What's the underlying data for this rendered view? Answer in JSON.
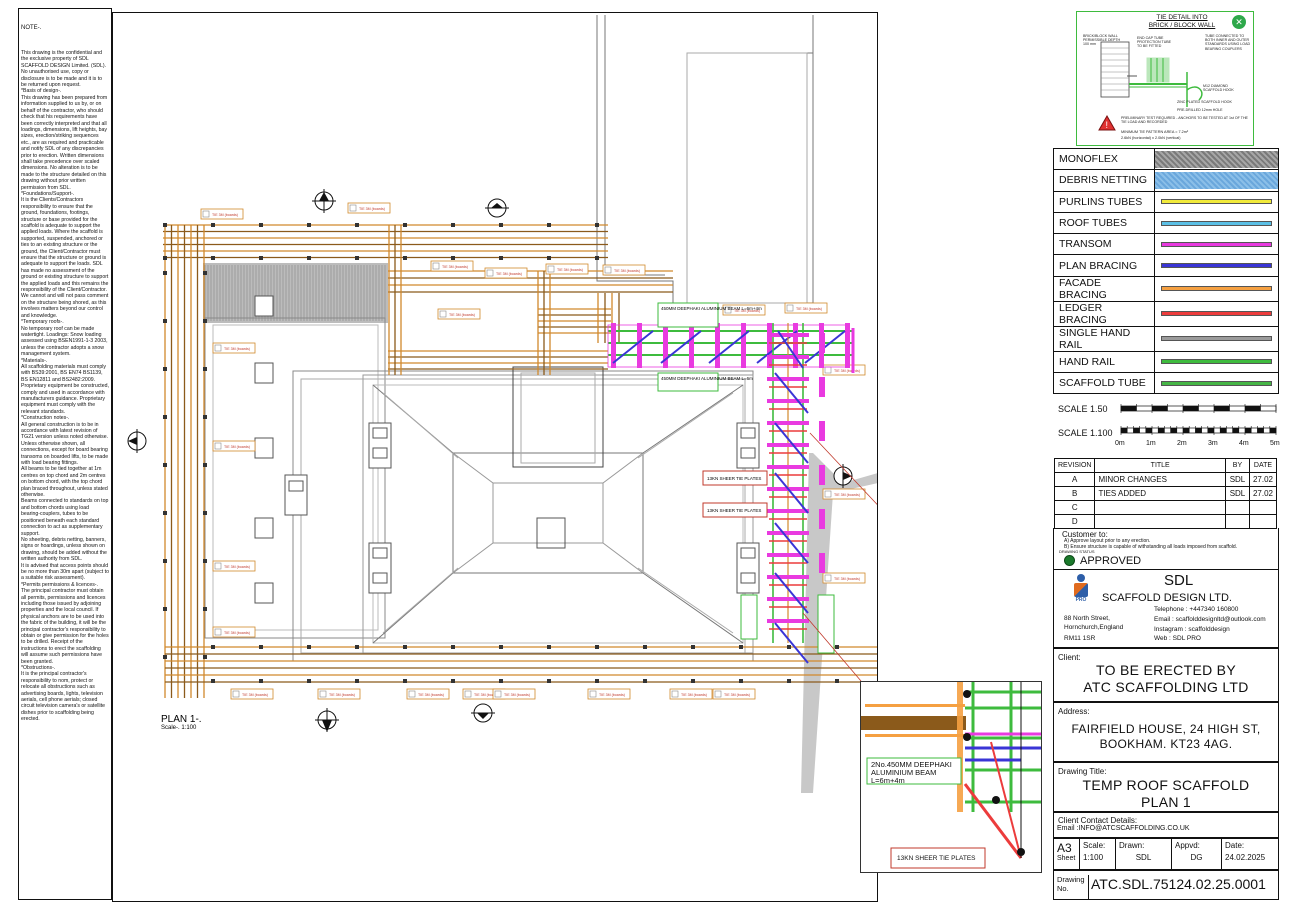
{
  "notes": {
    "heading": "NOTE-.",
    "body": "This drawing is the confidential and the exclusive property of SDL SCAFFOLD DESIGN Limited. (SDL). No unauthorised use, copy or disclosure is to be made and it is to be returned upon request.\n*Basis of design-.\nThis drawing has been prepared from information supplied to us by, or on behalf of the contractor, who should check that his requirements have been correctly interpreted and that all loadings, dimensions, lift heights, bay sizes, erection/striking sequences etc., are as required and practicable and notify SDL of any discrepancies prior to erection. Written dimensions shall take precedence over scaled dimensions. No alteration is to be made to the structure detailed on this drawing without prior written permission from SDL.\n*Foundations/Support-.\nIt is the Clients/Contractors responsibility to ensure that the ground, foundations, footings, structure or base provided for the scaffold is adequate to support the applied loads. Where the scaffold is supported, suspended, anchored or ties to an existing structure or the ground, the Client/Contractor must ensure that the structure or ground is adequate to support the loads. SDL has made no assessment of the ground or existing structure to support the applied loads and this remains the responsibility of the Client/Contractor. We cannot and will not pass comment on the structure being shored, as this involves matters beyond our control and knowledge.\n*Temporary roofs-.\nNo temporary roof can be made watertight. Loadings: Snow loading assessed using BSEN1991-1-3 2003, unless the contractor adopts a snow management system.\n*Materials-.\nAll scaffolding materials must comply with BS39:2001, BS EN74 BS1139, BS EN12811 and BS2482:2009. Proprietary equipment be constructed, comply and used in accordance with manufacturers guidance. Proprietary equipment must comply with the relevant standards.\n*Construction notes-.\nAll general construction is to be in accordance with latest revision of TG21 version unless noted otherwise.\nUnless otherwise shown, all connections, except for board bearing transoms on boarded lifts, to be made with load bearing fittings.\nAll beams to be tied together at 1m centres on top chord and 2m centres on bottom chord, with the top chord plan braced throughout, unless stated otherwise.\nBeams connected to standards on top and bottom chords using load bearing-couplers, tubes to be positioned beneath each standard connection to act as supplementary support.\nNo sheeting, debris netting, banners, signs or hoardings, unless shown on drawing, should be added without the written authority from SDL.\nIt is advised that access points should be no more than 30m apart (subject to a suitable risk assessment).\n*Permits permissions & licences-.\nThe principal contractor must obtain all permits, permissions and licences including those issued by adjoining properties and the local council. If physical anchors are to be used into the fabric of the building, it will be the principal contractor's responsibility to obtain or give permission for the holes to be drilled. Receipt of the instructions to erect the scaffolding will assume such permissions have been granted.\n*Obstructions-.\nIt is the principal contractor's responsibility to nom, protect or relocate all obstructions such as advertising boards, lights, television aerials, cell phone aerials; closed circuit television camera's or satellite dishes prior to scaffolding being erected."
  },
  "plan": {
    "label": "PLAN 1-.",
    "scale": "Scale-. 1:100",
    "section_markers": [
      "A",
      "1",
      "2",
      "3",
      "4"
    ],
    "callouts": {
      "beam_top": "450MM DEEPHAKI ALUMINIUM BEAM L=6m+4m",
      "beam_mid": "450MM DEEPHAKI ALUMINIUM BEAM L=6m",
      "tie_plate_1": "13KN SHEER TIE PLATES",
      "tie_plate_2": "13KN SHEER TIE PLATES",
      "tag": "TIE 3M (boards)"
    },
    "detail": {
      "beam_label": "2No.450MM DEEPHAKI ALUMINIUM BEAM L=6m+4m",
      "tie_label": "13KN SHEER TIE PLATES"
    }
  },
  "tie_detail": {
    "title": "TIE DETAIL INTO BRICK / BLOCK WALL",
    "notes": [
      "BRICK/BLOCK WALL PERMISSIBLE DEPTH 100 mm",
      "END CAP TUBE PROTECTION TUBE TO BE FITTED",
      "TUBE CONNECTED TO BOTH INNER AND OUTER STANDARDS USING LOAD BEARING COUPLERS",
      "M12 DIAMOND SCAFFOLD HOOK",
      "ZINC PLATED SCAFFOLD HOOK",
      "PRE-DRILLED 12mm HOLE",
      "PRELIMINARY TEST REQUIRED - ANCHORS TO BE TESTED AT 1st OF THE TIE LOAD AND RECORDED",
      "MINIMUM TIE PATTERN AREA = 7.2m²",
      "2.6kN (horizontal) x 2.0kN (vertical)"
    ]
  },
  "legend": [
    {
      "label": "MONOFLEX",
      "color": "#8c8c8c",
      "kind": "hatch"
    },
    {
      "label": "DEBRIS NETTING",
      "color": "#6aa7dc",
      "kind": "fill"
    },
    {
      "label": "PURLINS TUBES",
      "color": "#f1ea3b",
      "kind": "line"
    },
    {
      "label": "ROOF TUBES",
      "color": "#5bc0e6",
      "kind": "line"
    },
    {
      "label": "TRANSOM",
      "color": "#e93ae0",
      "kind": "line"
    },
    {
      "label": "PLAN BRACING",
      "color": "#3a35d6",
      "kind": "line"
    },
    {
      "label": "FACADE BRACING",
      "color": "#f5a041",
      "kind": "line"
    },
    {
      "label": "LEDGER BRACING",
      "color": "#ec3c3c",
      "kind": "line"
    },
    {
      "label": "SINGLE HAND RAIL",
      "color": "#9b9b9b",
      "kind": "line"
    },
    {
      "label": "HAND RAIL",
      "color": "#3ebb3e",
      "kind": "line"
    },
    {
      "label": "SCAFFOLD TUBE",
      "color": "#46b646",
      "kind": "line"
    }
  ],
  "scales": {
    "s1": "SCALE 1.50",
    "s2": "SCALE 1.100",
    "ticks": [
      "0m",
      "1m",
      "2m",
      "3m",
      "4m",
      "5m"
    ]
  },
  "revisions": {
    "headers": [
      "REVISION",
      "TITLE",
      "BY",
      "DATE"
    ],
    "rows": [
      {
        "rev": "A",
        "title": "MINOR CHANGES",
        "by": "SDL",
        "date": "27.02"
      },
      {
        "rev": "B",
        "title": "TIES ADDED",
        "by": "SDL",
        "date": "27.02"
      },
      {
        "rev": "C",
        "title": "",
        "by": "",
        "date": ""
      },
      {
        "rev": "D",
        "title": "",
        "by": "",
        "date": ""
      }
    ]
  },
  "customer": {
    "heading": "Customer to:",
    "line1": "A) Approve layout prior to any erection.",
    "line2": "B) Ensure structure is capable of withstanding all loads imposed from scaffold.",
    "status_label": "DRAWING STATUS",
    "status": "APPROVED"
  },
  "company": {
    "short": "SDL",
    "name": "SCAFFOLD DESIGN LTD.",
    "logo_text": "PRO",
    "addr1": "88 North Street,",
    "addr2": "Hornchurch,England",
    "addr3": "RM11 1SR",
    "tel": "Telephone : +447340 160800",
    "email": "Email : scaffolddesignltd@outlook.com",
    "insta": "Instagram : scaffolddesign",
    "web": "Web : SDL PRO"
  },
  "client": {
    "label": "Client:",
    "line1": "TO BE ERECTED BY",
    "line2": "ATC SCAFFOLDING LTD"
  },
  "address": {
    "label": "Address:",
    "line1": "FAIRFIELD HOUSE, 24 HIGH ST,",
    "line2": "BOOKHAM. KT23 4AG."
  },
  "drawing_title": {
    "label": "Drawing Title:",
    "line1": "TEMP ROOF SCAFFOLD",
    "line2": "PLAN 1"
  },
  "contact": {
    "label": "Client Contact Details:",
    "email": "Email :INFO@ATCSCAFFOLDING.CO.UK"
  },
  "title_block": {
    "size": "A3",
    "sheet": "Sheet",
    "scale_label": "Scale:",
    "scale": "1:100",
    "drawn_label": "Drawn:",
    "drawn": "SDL",
    "appvd_label": "Appvd:",
    "appvd": "DG",
    "date_label": "Date:",
    "date": "24.02.2025"
  },
  "drawing_no": {
    "label1": "Drawing",
    "label2": "No.",
    "value": "ATC.SDL.75124.02.25.0001"
  }
}
